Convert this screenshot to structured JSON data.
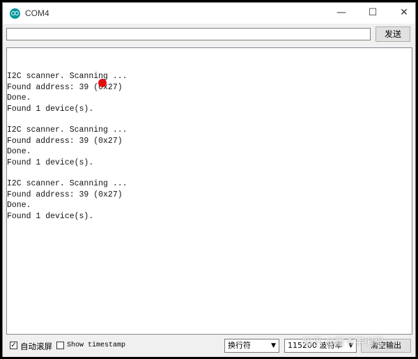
{
  "window": {
    "title": "COM4"
  },
  "window_controls": {
    "minimize": "—",
    "maximize": "☐",
    "close": "✕"
  },
  "send": {
    "input_value": "",
    "button_label": "发送"
  },
  "output": {
    "lines": [
      "",
      "I2C scanner. Scanning ...",
      "Found address: 39 (0x27)",
      "Done.",
      "Found 1 device(s).",
      "",
      "I2C scanner. Scanning ...",
      "Found address: 39 (0x27)",
      "Done.",
      "Found 1 device(s).",
      "",
      "I2C scanner. Scanning ...",
      "Found address: 39 (0x27)",
      "Done.",
      "Found 1 device(s)."
    ]
  },
  "status": {
    "autoscroll_label": "自动滚屏",
    "autoscroll_checked": true,
    "timestamp_label": "Show timestamp",
    "timestamp_checked": false,
    "line_ending": "换行符",
    "baud": "115200 波特率",
    "clear_label": "清空输出"
  },
  "watermark": "知乎 @雕爷学编程",
  "colors": {
    "marker_dot": "#e40c0c",
    "arduino_icon": "#00979c"
  }
}
